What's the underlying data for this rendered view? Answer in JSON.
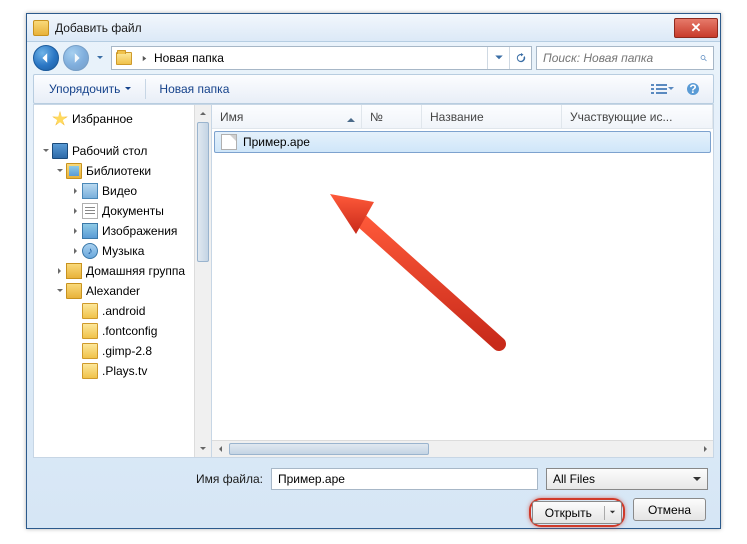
{
  "window": {
    "title": "Добавить файл"
  },
  "nav": {
    "breadcrumb": "Новая папка"
  },
  "search": {
    "placeholder": "Поиск: Новая папка"
  },
  "toolbar": {
    "organize": "Упорядочить",
    "new_folder": "Новая папка"
  },
  "sidebar": {
    "favorites": "Избранное",
    "desktop": "Рабочий стол",
    "libraries": "Библиотеки",
    "video": "Видео",
    "documents": "Документы",
    "pictures": "Изображения",
    "music": "Музыка",
    "homegroup": "Домашняя группа",
    "user": "Alexander",
    "f_android": ".android",
    "f_fontconfig": ".fontconfig",
    "f_gimp": ".gimp-2.8",
    "f_plays": ".Plays.tv"
  },
  "columns": {
    "name": "Имя",
    "num": "№",
    "title": "Название",
    "artists": "Участвующие ис..."
  },
  "files": {
    "item0": "Пример.ape"
  },
  "form": {
    "filename_label": "Имя файла:",
    "filename_value": "Пример.ape",
    "filter": "All Files"
  },
  "buttons": {
    "open": "Открыть",
    "cancel": "Отмена"
  }
}
